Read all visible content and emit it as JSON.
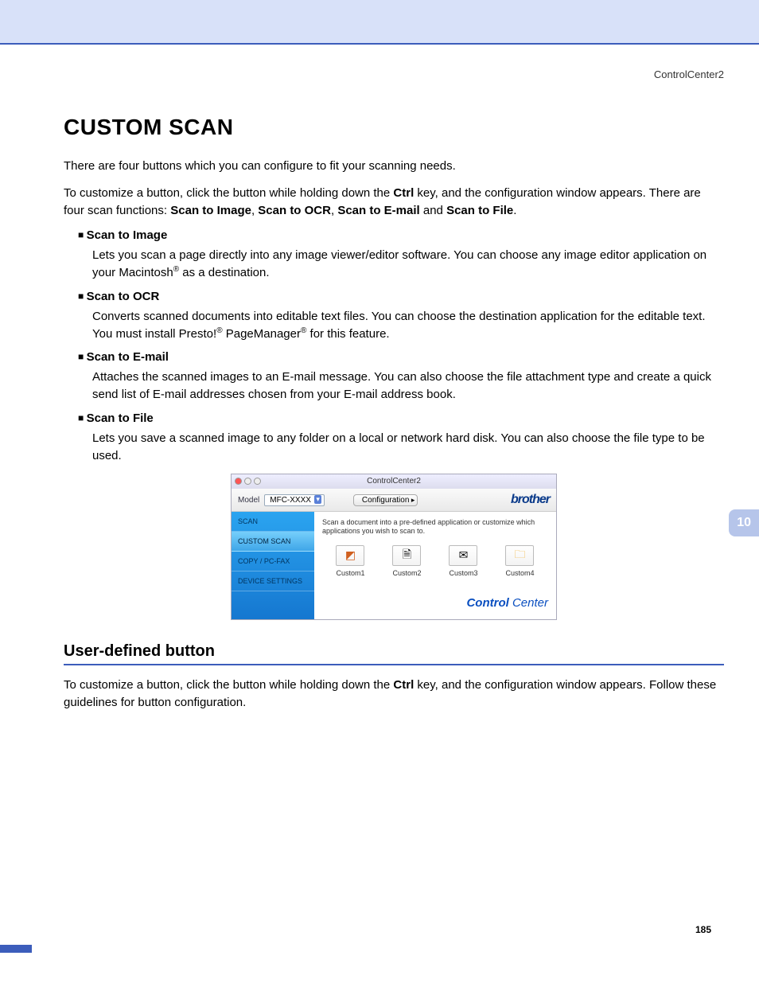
{
  "header": {
    "right": "ControlCenter2"
  },
  "title": "CUSTOM SCAN",
  "intro1": "There are four buttons which you can configure to fit your scanning needs.",
  "intro2_a": "To customize a button, click the button while holding down the ",
  "intro2_ctrl": "Ctrl",
  "intro2_b": " key, and the configuration window appears. There are four scan functions: ",
  "fn1": "Scan to Image",
  "fn2": "Scan to OCR",
  "fn3": "Scan to E-mail",
  "fn4": "Scan to File",
  "bullets": {
    "img_h": "Scan to Image",
    "img_b_a": "Lets you scan a page directly into any image viewer/editor software. You can choose any image editor application on your Macintosh",
    "img_b_b": " as a destination.",
    "ocr_h": "Scan to OCR",
    "ocr_b_a": "Converts scanned documents into editable text files. You can choose the destination application for the editable text. You must install Presto!",
    "ocr_b_b": " PageManager",
    "ocr_b_c": " for this feature.",
    "mail_h": "Scan to E-mail",
    "mail_b": "Attaches the scanned images to an E-mail message.  You can also choose the file attachment type and create a quick send list of E-mail addresses chosen from your E-mail address book.",
    "file_h": "Scan to File",
    "file_b": "Lets you save a scanned image to any folder on a local or network hard disk. You can also choose the file type to be used."
  },
  "mock": {
    "title": "ControlCenter2",
    "model_label": "Model",
    "model_value": "MFC-XXXX",
    "config_btn": "Configuration",
    "brand": "brother",
    "side": [
      "SCAN",
      "CUSTOM SCAN",
      "COPY / PC-FAX",
      "DEVICE SETTINGS"
    ],
    "desc": "Scan a document into a pre-defined application or customize which applications you wish to scan to.",
    "btns": [
      "Custom1",
      "Custom2",
      "Custom3",
      "Custom4"
    ],
    "cc_bold": "Control",
    "cc_light": " Center"
  },
  "h2": "User-defined button",
  "after_a": "To customize a button, click the button while holding down the ",
  "after_ctrl": "Ctrl",
  "after_b": " key, and the configuration window appears. Follow these guidelines for button configuration.",
  "tab": "10",
  "page": "185"
}
